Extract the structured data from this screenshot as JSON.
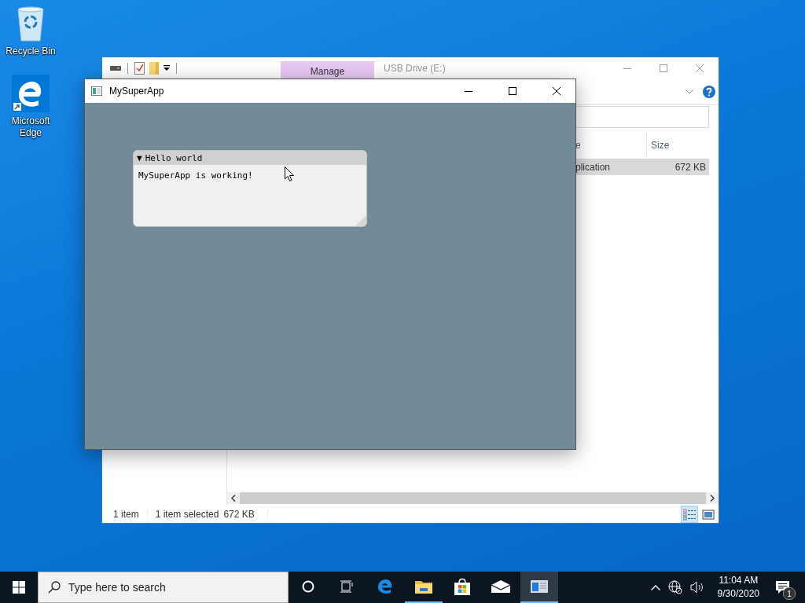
{
  "desktop_icons": [
    {
      "label": "Recycle Bin",
      "kind": "recycle"
    },
    {
      "label": "Microsoft Edge",
      "kind": "edge"
    }
  ],
  "explorer": {
    "ribbon_tab": "Manage",
    "title": "USB Drive (E:)",
    "columns": [
      "e",
      "Size"
    ],
    "rows": [
      {
        "cells": [
          "plication",
          "672 KB"
        ],
        "selected": true
      }
    ],
    "status_bar": {
      "count": "1 item",
      "selection": "1 item selected",
      "size": "672 KB"
    },
    "views": [
      {
        "kind": "details",
        "selected": true
      },
      {
        "kind": "large",
        "selected": false
      }
    ]
  },
  "app": {
    "title": "MySuperApp",
    "panel": {
      "toggle": "▼",
      "title": "Hello world",
      "text": "MySuperApp is working!"
    }
  },
  "taskbar": {
    "search": {
      "placeholder": "Type here to search"
    },
    "apps": [
      {
        "kind": "cortana",
        "running": false,
        "active": false
      },
      {
        "kind": "taskview",
        "running": false,
        "active": false
      },
      {
        "kind": "edge",
        "running": false,
        "active": false
      },
      {
        "kind": "explorer",
        "running": true,
        "active": false
      },
      {
        "kind": "store",
        "running": false,
        "active": false
      },
      {
        "kind": "mail",
        "running": false,
        "active": false
      },
      {
        "kind": "app",
        "running": true,
        "active": true
      }
    ],
    "clock": {
      "time": "11:04 AM",
      "date": "9/30/2020"
    },
    "notifications": {
      "count": "1"
    }
  }
}
